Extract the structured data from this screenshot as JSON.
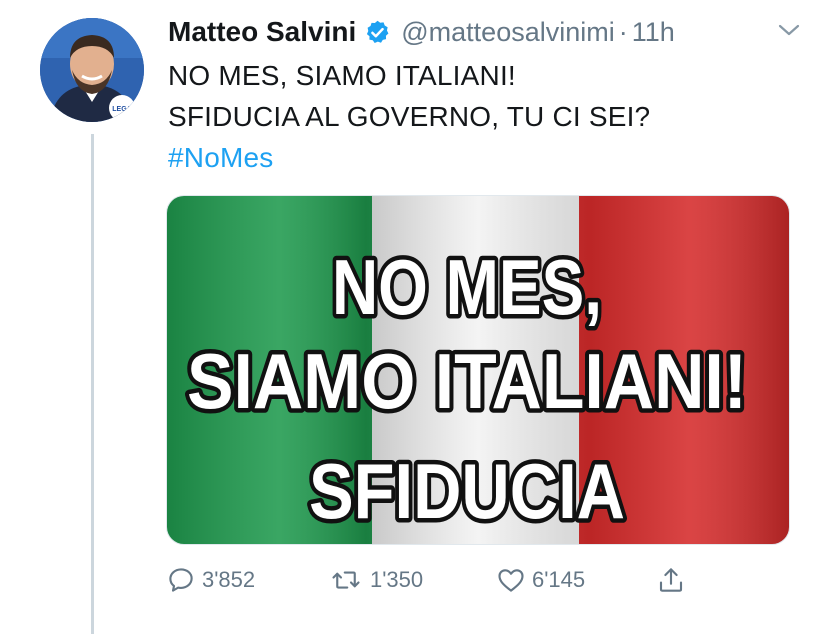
{
  "tweet": {
    "author_name": "Matteo Salvini",
    "handle": "@matteosalvinimi",
    "separator": "·",
    "time": "11h",
    "lines": [
      "NO MES, SIAMO ITALIANI!",
      "SFIDUCIA AL GOVERNO, TU CI SEI?"
    ],
    "hashtag": "#NoMes",
    "avatar_badge": "LEGA"
  },
  "media": {
    "headline_line1": "NO MES,",
    "headline_line2": "SIAMO ITALIANI!",
    "headline_line3": "SFIDUCIA",
    "flag_colors": {
      "green": "#1f9a4e",
      "white": "#f2f2f2",
      "red": "#d52b2b"
    }
  },
  "actions": {
    "replies": "3'852",
    "retweets": "1'350",
    "likes": "6'145"
  },
  "icons": [
    "verified-badge-icon",
    "chevron-down-icon",
    "reply-icon",
    "retweet-icon",
    "like-icon",
    "share-icon"
  ],
  "colors": {
    "accent": "#1da1f2",
    "muted": "#657786",
    "text": "#14171a",
    "thread_line": "#ccd6dd"
  }
}
